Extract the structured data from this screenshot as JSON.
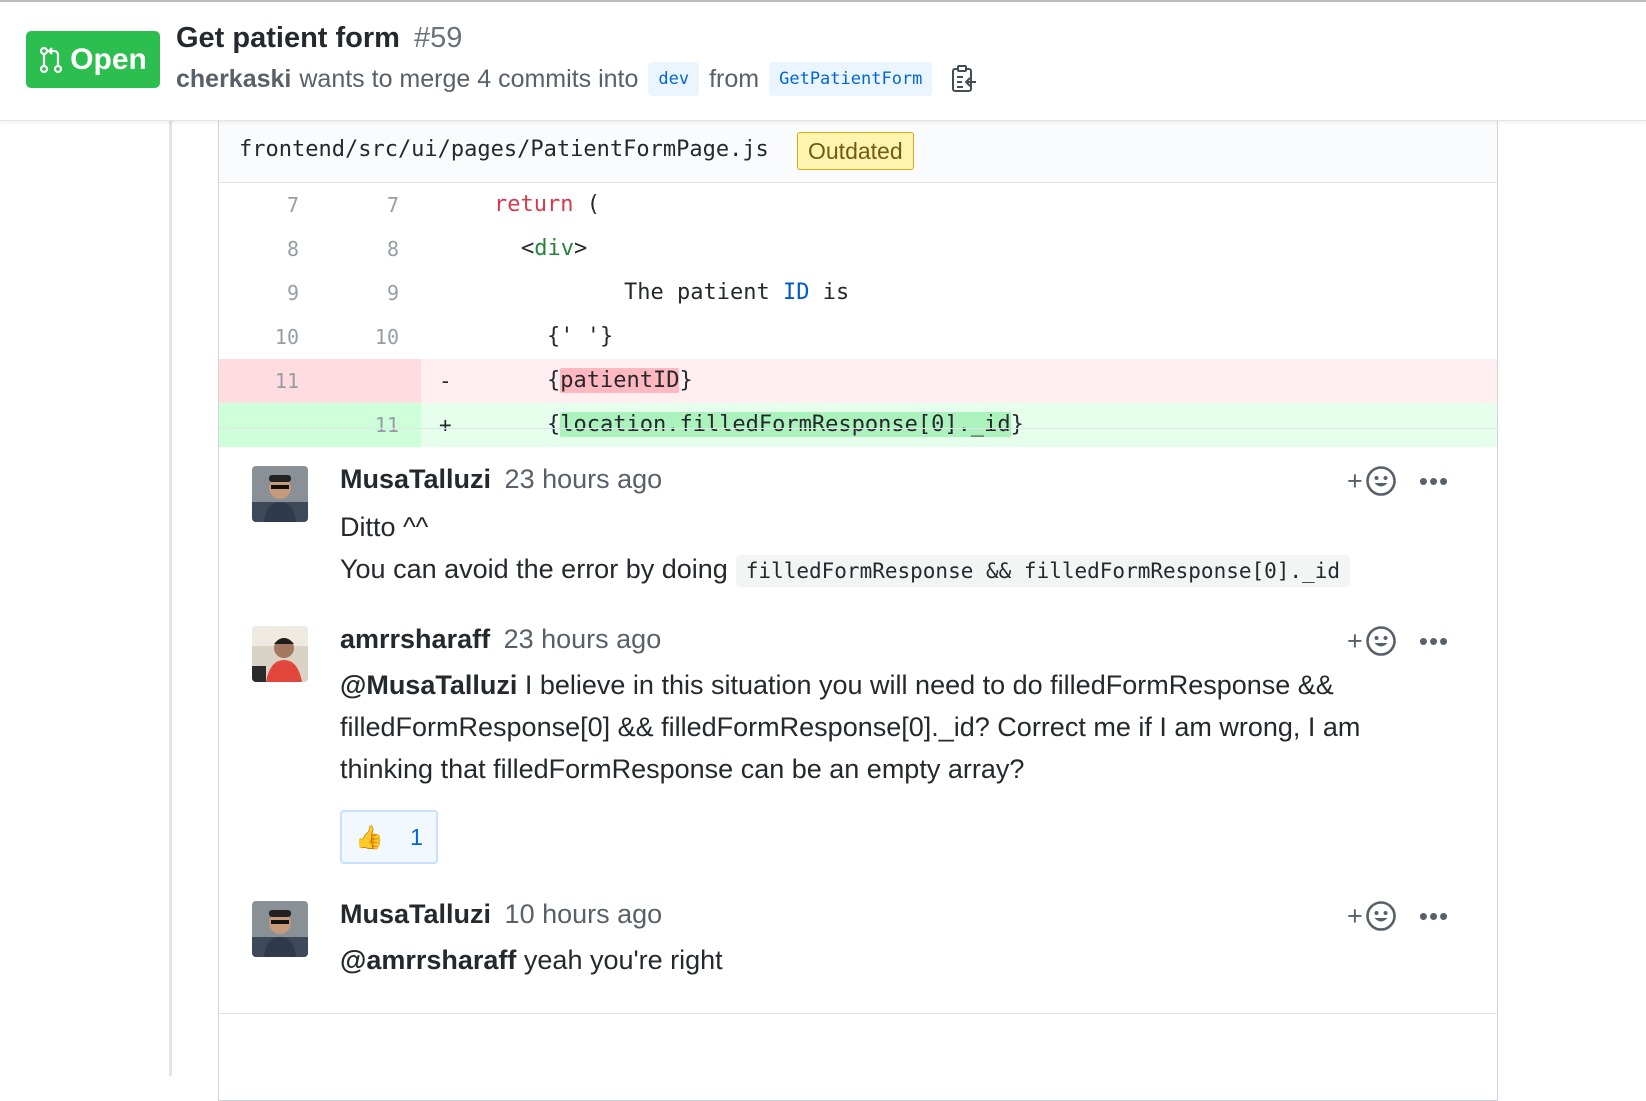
{
  "header": {
    "status": "Open",
    "title": "Get patient form",
    "number": "#59",
    "author": "cherkaski",
    "merge_text": "wants to merge 4 commits into",
    "base_branch": "dev",
    "from_text": "from",
    "head_branch": "GetPatientForm"
  },
  "file": {
    "path": "frontend/src/ui/pages/PatientFormPage.js",
    "badge": "Outdated"
  },
  "diff": {
    "rows": [
      {
        "old": "7",
        "new": "7"
      },
      {
        "old": "8",
        "new": "8"
      },
      {
        "old": "9",
        "new": "9"
      },
      {
        "old": "10",
        "new": "10"
      },
      {
        "old": "11",
        "new": "",
        "sign": "-"
      },
      {
        "old": "",
        "new": "11",
        "sign": "+"
      }
    ],
    "line7_kw": "return",
    "line7_rest": " (",
    "line8_open": "<",
    "line8_tag": "div",
    "line8_close": ">",
    "line9_a": "The patient ",
    "line9_id": "ID",
    "line9_b": " is",
    "line10": "{' '}",
    "line11_del_open": "{",
    "line11_del_hl": "patientID",
    "line11_del_close": "}",
    "line11_add_open": "{",
    "line11_add_hl": "location.filledFormResponse[0]._id",
    "line11_add_close": "}"
  },
  "comments": [
    {
      "user": "MusaTalluzi",
      "time": "23 hours ago",
      "line1": "Ditto ^^",
      "line2": "You can avoid the error by doing",
      "code": "filledFormResponse && filledFormResponse[0]._id"
    },
    {
      "user": "amrrsharaff",
      "time": "23 hours ago",
      "mention": "@MusaTalluzi",
      "line1_rest": " I believe in this situation you will need to do filledFormResponse &&",
      "line2": "filledFormResponse[0] && filledFormResponse[0]._id? Correct me if I am wrong, I am",
      "line3": "thinking that filledFormResponse can be an empty array?",
      "reaction_emoji": "👍",
      "reaction_count": "1"
    },
    {
      "user": "MusaTalluzi",
      "time": "10 hours ago",
      "mention": "@amrrsharaff",
      "body_rest": " yeah you're right"
    }
  ],
  "icons": {
    "status": "git-pull-request-icon",
    "copy": "clipboard-copy-icon",
    "add_reaction": "smiley-icon",
    "more": "kebab-horizontal-icon"
  },
  "colors": {
    "open_green": "#2cbe4e",
    "link_blue": "#0366d6",
    "deletion_bg": "#ffeef0",
    "addition_bg": "#e6ffed",
    "outdated_bg": "#fff5b1"
  }
}
